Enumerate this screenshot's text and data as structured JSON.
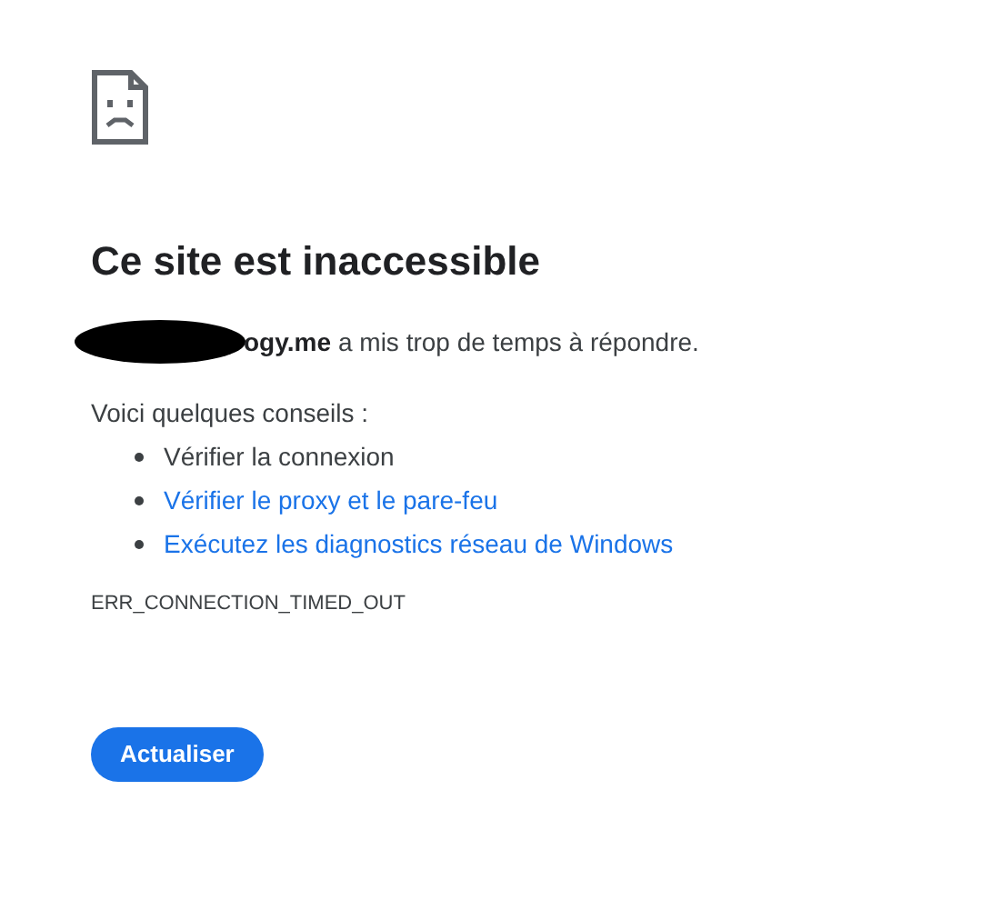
{
  "title": "Ce site est inaccessible",
  "message": {
    "host": "ogy.me",
    "rest": "a mis trop de temps à répondre.",
    "redacted": true
  },
  "tips_heading": "Voici quelques conseils :",
  "tips": [
    {
      "kind": "text",
      "label": "Vérifier la connexion"
    },
    {
      "kind": "link",
      "label": "Vérifier le proxy et le pare-feu"
    },
    {
      "kind": "link",
      "label": "Exécutez les diagnostics réseau de Windows"
    }
  ],
  "error_code": "ERR_CONNECTION_TIMED_OUT",
  "button": "Actualiser"
}
